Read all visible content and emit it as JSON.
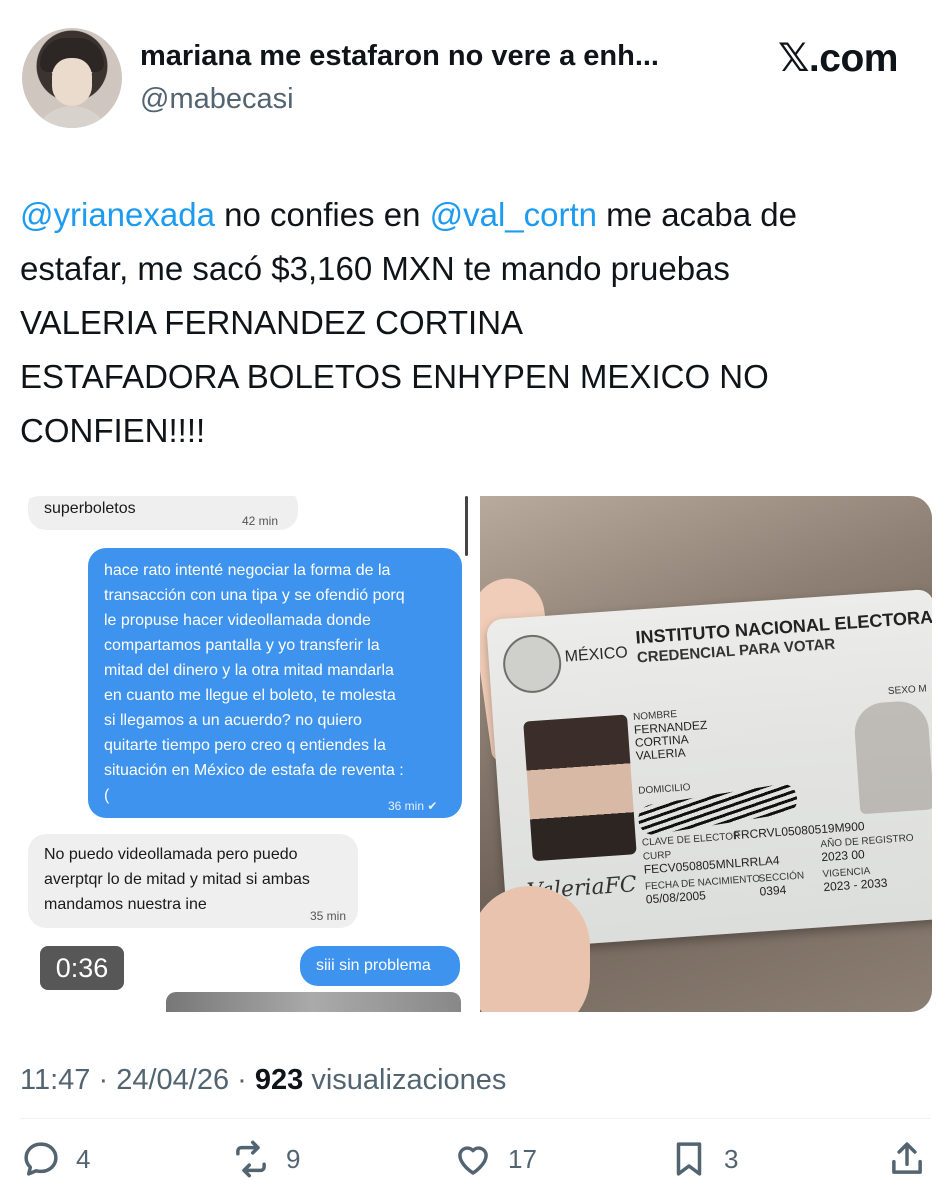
{
  "header": {
    "display_name": "mariana me estafaron no vere a enh...",
    "handle": "@mabecasi",
    "site_logo": ".com"
  },
  "tweet": {
    "lines": [
      [
        {
          "t": "@yrianexada",
          "m": true
        },
        {
          "t": " no confies en ",
          "m": false
        },
        {
          "t": "@val_cortn",
          "m": true
        },
        {
          "t": " me acaba de",
          "m": false
        }
      ],
      [
        {
          "t": "estafar, me sacó $3,160 MXN te mando pruebas",
          "m": false
        }
      ],
      [
        {
          "t": "VALERIA FERNANDEZ CORTINA",
          "m": false
        }
      ],
      [
        {
          "t": "ESTAFADORA BOLETOS ENHYPEN MEXICO NO",
          "m": false
        }
      ],
      [
        {
          "t": "CONFIEN!!!!",
          "m": false
        }
      ]
    ]
  },
  "media": {
    "video_duration": "0:36",
    "chat": {
      "msg1_text": "superboletos",
      "msg1_time": "42 min",
      "msg2_lines": [
        "hace rato intenté negociar la forma de la",
        "transacción con una tipa y se ofendió porq",
        "le propuse hacer videollamada donde",
        "compartamos pantalla y yo transferir la",
        "mitad del dinero y la otra mitad mandarla",
        "en cuanto me llegue el boleto, te molesta",
        "si llegamos a un acuerdo? no quiero",
        "quitarte tiempo pero creo q entiendes la",
        "situación en México de estafa de reventa :",
        "("
      ],
      "msg2_time": "36 min",
      "msg3_lines": [
        "No puedo videollamada pero puedo",
        "averptqr lo de mitad y mitad si ambas",
        "mandamos nuestra ine"
      ],
      "msg3_time": "35 min",
      "msg4_text": "siii sin problema"
    },
    "id_card": {
      "country": "MÉXICO",
      "institute": "INSTITUTO NACIONAL ELECTORAL",
      "credential": "CREDENCIAL PARA VOTAR",
      "nombre_label": "NOMBRE",
      "name_lines": [
        "FERNANDEZ",
        "CORTINA",
        "VALERIA"
      ],
      "sexo": "SEXO M",
      "domicilio_label": "DOMICILIO",
      "clave_label": "CLAVE DE ELECTOR",
      "clave_value": "FRCRVL05080519M900",
      "curp_label": "CURP",
      "curp_value": "FECV050805MNLRRLA4",
      "registro_label": "AÑO DE REGISTRO",
      "registro_value": "2023 00",
      "nacimiento_label": "FECHA DE NACIMIENTO",
      "nacimiento_value": "05/08/2005",
      "seccion_label": "SECCIÓN",
      "seccion_value": "0394",
      "vigencia_label": "VIGENCIA",
      "vigencia_value": "2023 - 2033",
      "signature": "ValeriaFC"
    }
  },
  "meta": {
    "time": "11:47",
    "date": "24/04/26",
    "separator": "·",
    "views_count": "923",
    "views_label": "visualizaciones"
  },
  "actions": {
    "replies": "4",
    "reposts": "9",
    "likes": "17",
    "bookmarks": "3"
  },
  "icons": [
    "reply-icon",
    "repost-icon",
    "like-icon",
    "bookmark-icon",
    "share-icon"
  ],
  "colors": {
    "link": "#1d9bf0",
    "muted": "#536471",
    "chat_blue": "#3e93ee"
  }
}
